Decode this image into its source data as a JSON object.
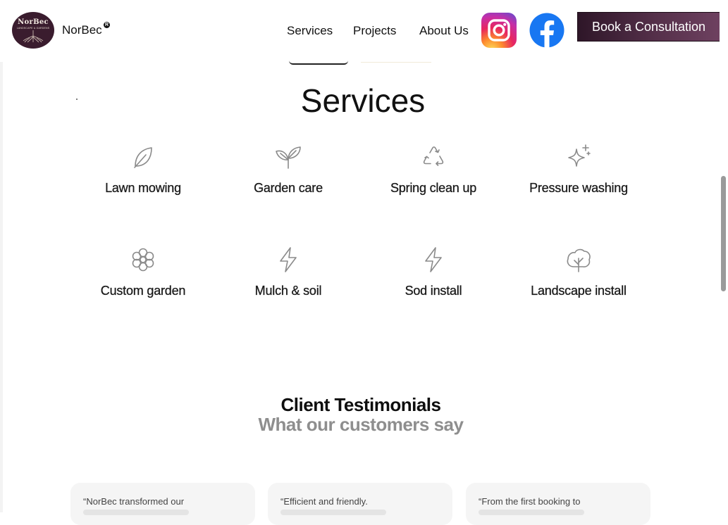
{
  "header": {
    "logo": {
      "word": "NorBec",
      "tagline": "LANDSCAPE & GARDENS"
    },
    "brand_name": "NorBec",
    "brand_mark": "R",
    "nav": [
      {
        "label": "Services"
      },
      {
        "label": "Projects"
      },
      {
        "label": "About Us"
      }
    ],
    "social": [
      {
        "icon": "instagram-icon"
      },
      {
        "icon": "facebook-icon"
      }
    ],
    "cta_label": "Book a Consultation",
    "colors": {
      "cta_dark": "#2e1628",
      "cta_light": "#6e4160",
      "logo_bg": "#3a1c2e",
      "facebook": "#1877f2"
    }
  },
  "services": {
    "title": "Services",
    "items": [
      {
        "label": "Lawn mowing",
        "icon": "leaf-icon"
      },
      {
        "label": "Garden care",
        "icon": "sprout-icon"
      },
      {
        "label": "Spring clean up",
        "icon": "recycle-icon"
      },
      {
        "label": "Pressure washing",
        "icon": "sparkles-icon"
      },
      {
        "label": "Custom garden",
        "icon": "flower-icon"
      },
      {
        "label": "Mulch & soil",
        "icon": "lightning-icon"
      },
      {
        "label": "Sod install",
        "icon": "lightning-icon"
      },
      {
        "label": "Landscape install",
        "icon": "tree-icon"
      }
    ]
  },
  "testimonials": {
    "title": "Client Testimonials",
    "subtitle": "What our customers say",
    "cards": [
      {
        "quote": "“NorBec transformed our"
      },
      {
        "quote": "“Efficient and friendly."
      },
      {
        "quote": "“From the first booking to"
      }
    ]
  }
}
